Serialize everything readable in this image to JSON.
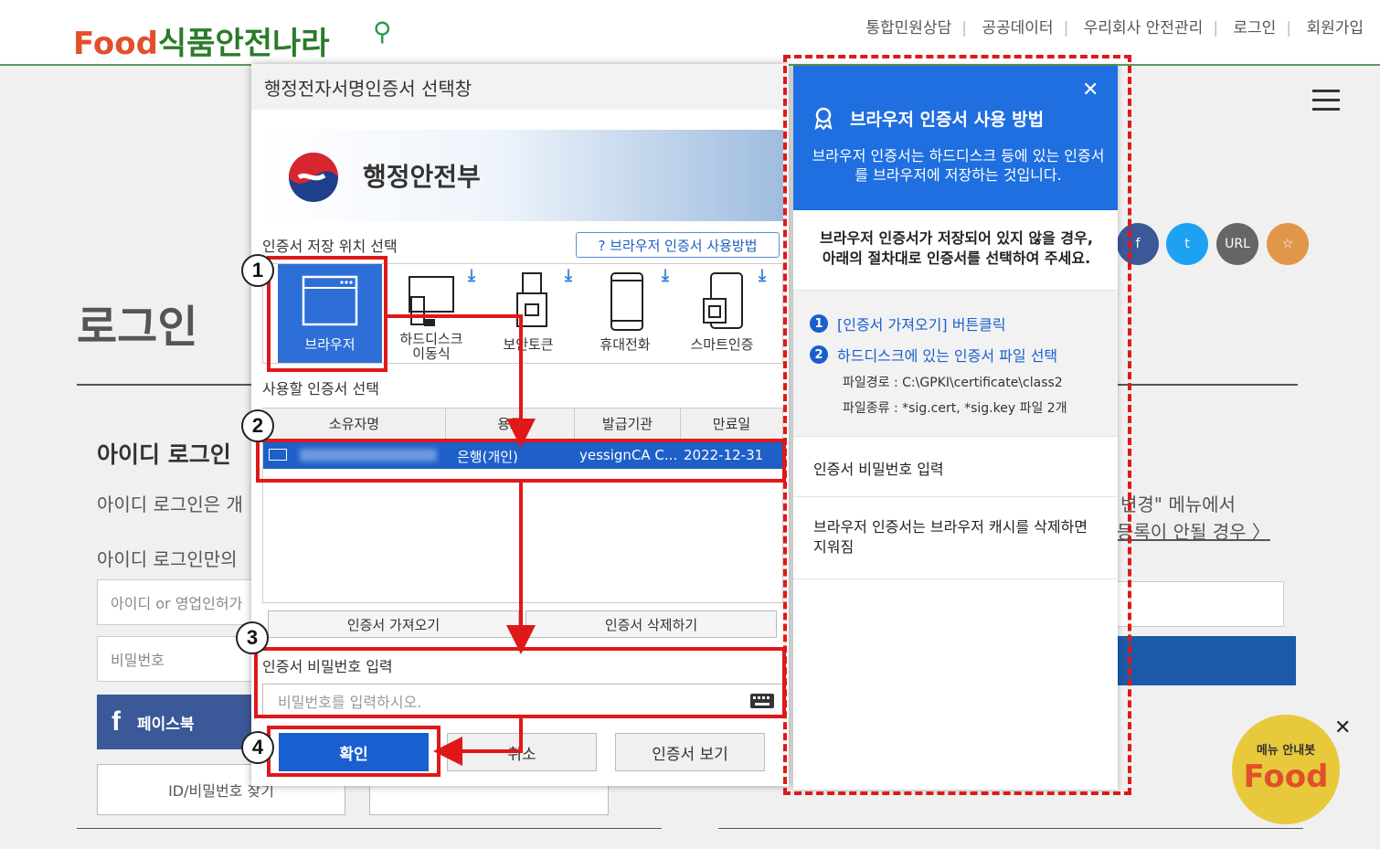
{
  "site": {
    "top_nav": [
      "통합민원상담",
      "공공데이터",
      "우리회사 안전관리",
      "로그인",
      "회원가입"
    ],
    "logo_text": "식품안전나라",
    "page_title": "로그인",
    "id_login_heading": "아이디 로그인",
    "id_login_desc1": "아이디 로그인은 개",
    "id_login_desc2": "아이디 로그인만의",
    "id_placeholder": "아이디 or 영업인허가",
    "pw_placeholder": "비밀번호",
    "facebook_label": "페이스북",
    "find_id_label": "ID/비밀번호 찾기",
    "right_text1": "변경\" 메뉴에서",
    "right_text2": "등록이 안될 경우 〉",
    "share": [
      "f",
      "t",
      "URL",
      "☆"
    ],
    "chatbot_label": "메뉴 안내봇",
    "chatbot_brand": "Food",
    "close_glyph": "✕"
  },
  "dialog": {
    "title": "행정전자서명인증서 선택창",
    "ministry": "행정안전부",
    "storage_label": "인증서 저장 위치 선택",
    "help_button": "? 브라우저 인증서 사용방법",
    "storage_options": [
      "브라우저",
      "하드디스크\n이동식",
      "보안토큰",
      "휴대전화",
      "스마트인증"
    ],
    "cert_label": "사용할 인증서 선택",
    "columns": [
      "소유자명",
      "용도",
      "발급기관",
      "만료일"
    ],
    "row": {
      "owner": "",
      "usage": "은행(개인)",
      "issuer": "yessignCA C...",
      "expiry": "2022-12-31"
    },
    "import_button": "인증서 가져오기",
    "delete_button": "인증서 삭제하기",
    "password_label": "인증서 비밀번호 입력",
    "password_placeholder": "비밀번호를 입력하시오.",
    "ok_button": "확인",
    "cancel_button": "취소",
    "view_button": "인증서 보기"
  },
  "help_panel": {
    "title": "브라우저 인증서 사용 방법",
    "description": "브라우저 인증서는 하드디스크 등에 있는 인증서를 브라우저에 저장하는 것입니다.",
    "notice": "브라우저 인증서가 저장되어 있지 않을 경우, 아래의 절차대로 인증서를 선택하여 주세요.",
    "step1": "[인증서 가져오기] 버튼클릭",
    "step2": "하드디스크에 있는 인증서 파일 선택",
    "file_path": "파일경로 : C:\\GPKI\\certificate\\class2",
    "file_type": "파일종류 : *sig.cert, *sig.key 파일 2개",
    "password_item": "인증서 비밀번호 입력",
    "cache_note": "브라우저 인증서는 브라우저 캐시를 삭제하면 지워짐"
  },
  "annotations": {
    "n1": "1",
    "n2": "2",
    "n3": "3",
    "n4": "4"
  },
  "colors": {
    "accent": "#1f6fe0",
    "annotation": "#e01818",
    "facebook": "#3b5998"
  }
}
